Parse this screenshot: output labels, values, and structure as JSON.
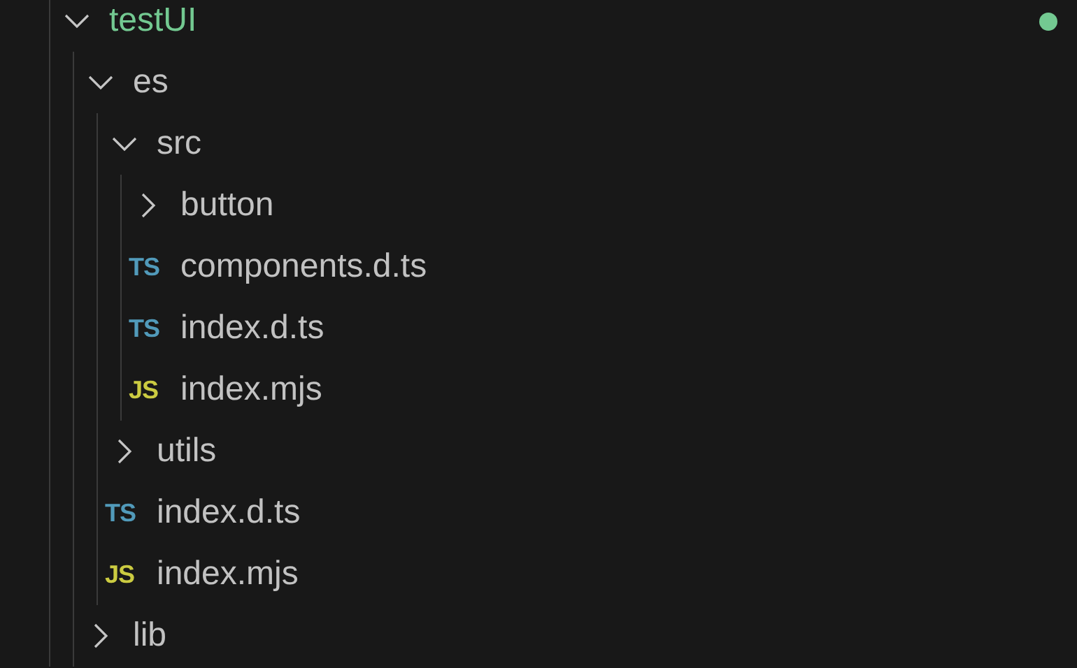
{
  "explorer": {
    "tree": [
      {
        "kind": "folder",
        "name": "testUI",
        "expanded": true,
        "untracked": true,
        "children": [
          {
            "kind": "folder",
            "name": "es",
            "expanded": true,
            "children": [
              {
                "kind": "folder",
                "name": "src",
                "expanded": true,
                "children": [
                  {
                    "kind": "folder",
                    "name": "button",
                    "expanded": false
                  },
                  {
                    "kind": "file",
                    "icon": "TS",
                    "name": "components.d.ts"
                  },
                  {
                    "kind": "file",
                    "icon": "TS",
                    "name": "index.d.ts"
                  },
                  {
                    "kind": "file",
                    "icon": "JS",
                    "name": "index.mjs"
                  }
                ]
              },
              {
                "kind": "folder",
                "name": "utils",
                "expanded": false
              },
              {
                "kind": "file",
                "icon": "TS",
                "name": "index.d.ts"
              },
              {
                "kind": "file",
                "icon": "JS",
                "name": "index.mjs"
              }
            ]
          },
          {
            "kind": "folder",
            "name": "lib",
            "expanded": false
          }
        ]
      }
    ]
  }
}
